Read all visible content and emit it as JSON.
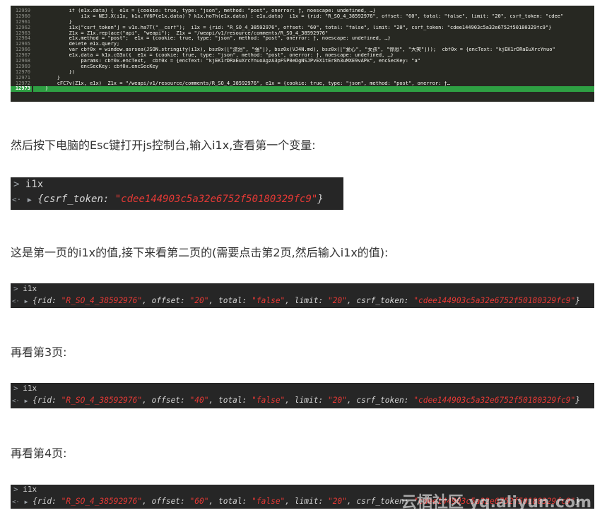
{
  "editor": {
    "line_numbers": [
      "12959",
      "12960",
      "12961",
      "12962",
      "12963",
      "12964",
      "12965",
      "12966",
      "12967",
      "12968",
      "12969",
      "12970",
      "12971",
      "12972",
      "12973"
    ],
    "code": [
      "            if (e1x.data) {  e1x = {cookie: true, type: \"json\", method: \"post\", onerror: ƒ, noescape: undefined, …}",
      "                i1x = NEJ.X(i1x, k1x.fV6P(e1x.data) ? k1x.ho7h(e1x.data) : e1x.data)  i1x = {rid: \"R_SO_4_38592976\", offset: \"60\", total: \"false\", limit: \"20\", csrf_token: \"cdee\"",
      "            }",
      "            i1x[\"csrf_token\"] = v1x.ha7T(\"__csrf\");  i1x = {rid: \"R_SO_4_38592976\", offset: \"60\", total: \"false\", limit: \"20\", csrf_token: \"cdee144903c5a32e6752f50180329fc9\"}",
      "            Z1x = Z1x.replace(\"api\", \"weapi\");  Z1x = \"/weapi/v1/resource/comments/R_SO_4_38592976\"",
      "            e1x.method = \"post\";  e1x = {cookie: true, type: \"json\", method: \"post\", onerror: ƒ, noescape: undefined, …}",
      "            delete e1x.query;",
      "            var cbf0x = window.asrsea(JSON.stringify(i1x), bsz0x([\"流泪\", \"强\"]), bsz0x(VJ4N.md), bsz0x([\"爱心\", \"女孩\", \"惊恐\", \"大笑\"]));  cbf0x = {encText: \"kjEK1rDRaEuXrcYnuo\"",
      "            e1x.data = k1x.cG3x({  e1x = {cookie: true, type: \"json\", method: \"post\", onerror: ƒ, noescape: undefined, …}",
      "                params: cbf0x.encText,  cbf0x = {encText: \"kjEK1rDRaEuXrcYnuoAgzA3pFSP0eDgNSJPvEX1tEr8h3uMXE9vAPk\", encSecKey: \"a\"",
      "                encSecKey: cbf0x.encSecKey",
      "            })",
      "        }",
      "        cFC7v(Z1x, e1x)  Z1x = \"/weapi/v1/resource/comments/R_SO_4_38592976\", e1x = {cookie: true, type: \"json\", method: \"post\", onerror: ƒ…",
      "    }"
    ]
  },
  "paragraphs": {
    "p1": "然后按下电脑的Esc键打开js控制台,输入i1x,查看第一个变量:",
    "p2": "这是第一页的i1x的值,接下来看第二页的(需要点击第2页,然后输入i1x的值):",
    "p3": "再看第3页:",
    "p4": "再看第4页:"
  },
  "consoles": {
    "c1": {
      "input": "i1x",
      "csrf_key": "csrf_token",
      "csrf": "\"cdee144903c5a32e6752f50180329fc9\""
    },
    "c2": {
      "input": "i1x",
      "rid": "\"R_SO_4_38592976\"",
      "offset": "\"20\"",
      "total": "\"false\"",
      "limit": "\"20\"",
      "csrf": "\"cdee144903c5a32e6752f50180329fc9\""
    },
    "c3": {
      "input": "i1x",
      "rid": "\"R_SO_4_38592976\"",
      "offset": "\"40\"",
      "total": "\"false\"",
      "limit": "\"20\"",
      "csrf": "\"cdee144903c5a32e6752f50180329fc9\""
    },
    "c4": {
      "input": "i1x",
      "rid": "\"R_SO_4_38592976\"",
      "offset": "\"60\"",
      "total": "\"false\"",
      "limit": "\"20\"",
      "csrf": "\"cdee144903c5a32e6752f50180329fc9\""
    }
  },
  "labels": {
    "prompt": ">",
    "out": "<·",
    "expand": "▶",
    "rid_key": "rid:",
    "offset_key": "offset:",
    "total_key": "total:",
    "limit_key": "limit:",
    "csrf_key": "csrf_token:"
  },
  "watermark": "云栖社区 yq.aliyun.com",
  "colors": {
    "editor_bg": "#272822",
    "current_line": "#2ea043",
    "console_bg": "#262626",
    "string": "#e53935"
  }
}
